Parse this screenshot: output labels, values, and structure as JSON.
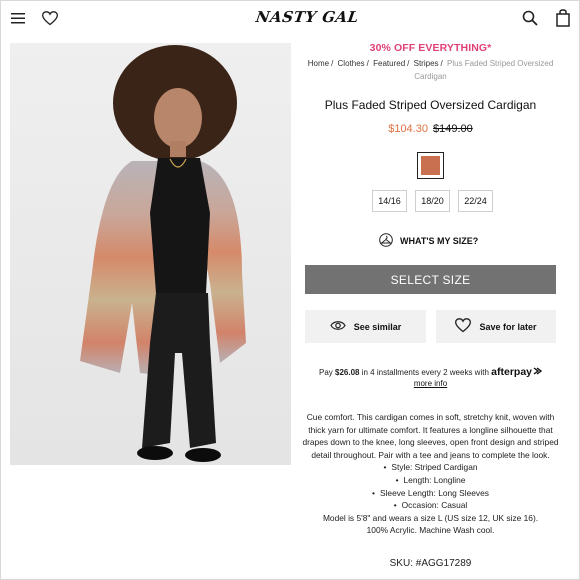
{
  "header": {
    "logo_text": "NASTY GAL",
    "menu_icon": "hamburger-menu-icon",
    "wishlist_icon": "heart-icon",
    "search_icon": "search-icon",
    "bag_icon": "shopping-bag-icon"
  },
  "promo": "30% OFF EVERYTHING*",
  "breadcrumb": {
    "items": [
      "Home",
      "Clothes",
      "Featured",
      "Stripes"
    ],
    "current": "Plus Faded Striped Oversized Cardigan",
    "separator": "/"
  },
  "product": {
    "title": "Plus Faded Striped Oversized Cardigan",
    "price_now": "$104.30",
    "price_was": "$149.00",
    "swatch_color": "#c8704f",
    "sizes": [
      "14/16",
      "18/20",
      "22/24"
    ],
    "whats_my_size": "WHAT'S MY SIZE?",
    "select_size": "SELECT SIZE",
    "see_similar": "See similar",
    "save_for_later": "Save for later"
  },
  "afterpay": {
    "pay": "Pay",
    "amount": "$26.08",
    "text": "in 4 installments every 2 weeks with",
    "logo": "afterpay",
    "more_info": "more info"
  },
  "description": {
    "intro": "Cue comfort. This cardigan comes in soft, stretchy knit, woven with thick yarn for ultimate comfort. It features a longline silhouette that drapes down to the knee, long sleeves, open front design and striped detail throughout. Pair with a tee and jeans to complete the look.",
    "bullets": [
      "Style: Striped Cardigan",
      "Length: Longline",
      "Sleeve Length: Long Sleeves",
      "Occasion: Casual"
    ],
    "model": "Model is 5'8\" and wears a size L (US size 12, UK size 16).",
    "material": "100% Acrylic. Machine Wash cool."
  },
  "sku": "SKU: #AGG17289",
  "colors": {
    "promo": "#e0407a",
    "price_now": "#e07040",
    "select_button": "#727272",
    "action_bg": "#f1f1f1"
  }
}
